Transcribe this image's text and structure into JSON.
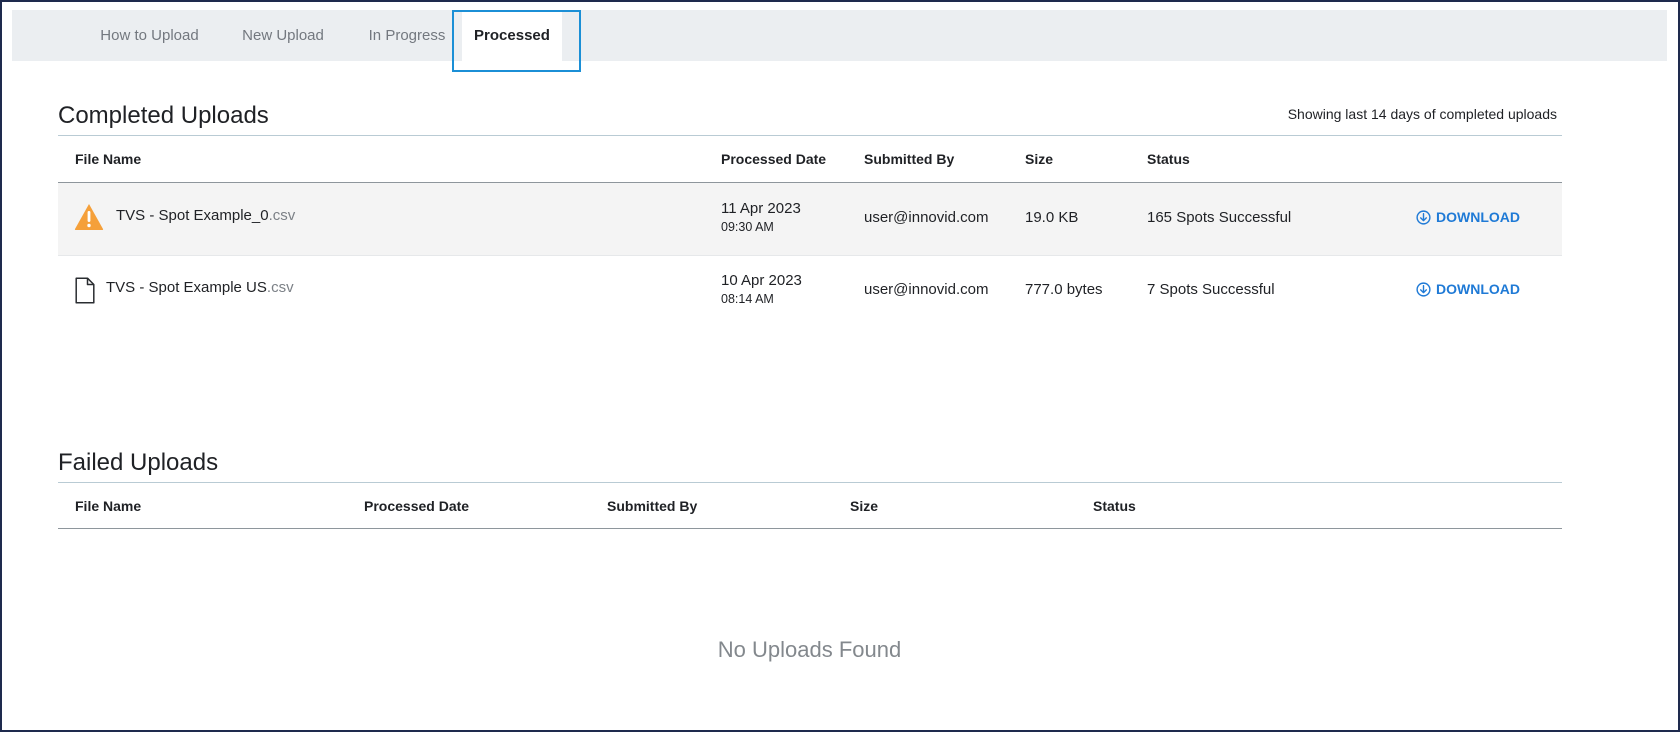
{
  "tabs": [
    {
      "label": "How to Upload"
    },
    {
      "label": "New Upload"
    },
    {
      "label": "In Progress"
    },
    {
      "label": "Processed"
    }
  ],
  "active_tab": "Processed",
  "completed": {
    "title": "Completed Uploads",
    "meta": "Showing last 14 days of completed uploads",
    "headers": {
      "file_name": "File Name",
      "processed_date": "Processed Date",
      "submitted_by": "Submitted By",
      "size": "Size",
      "status": "Status"
    },
    "rows": [
      {
        "icon": "warning-icon",
        "file_base": "TVS - Spot Example_0",
        "file_ext": ".csv",
        "date": "11 Apr 2023",
        "time": "09:30 AM",
        "submitted_by": "user@innovid.com",
        "size": "19.0 KB",
        "status": "165 Spots Successful",
        "action": "DOWNLOAD"
      },
      {
        "icon": "file-icon",
        "file_base": "TVS - Spot Example US",
        "file_ext": ".csv",
        "date": "10 Apr 2023",
        "time": "08:14 AM",
        "submitted_by": "user@innovid.com",
        "size": "777.0 bytes",
        "status": "7 Spots Successful",
        "action": "DOWNLOAD"
      }
    ]
  },
  "failed": {
    "title": "Failed Uploads",
    "headers": {
      "file_name": "File Name",
      "processed_date": "Processed Date",
      "submitted_by": "Submitted By",
      "size": "Size",
      "status": "Status"
    },
    "empty_text": "No Uploads Found"
  },
  "colors": {
    "accent": "#1f7ad6",
    "warning": "#f5a03a",
    "focus_ring": "#1b8fd6",
    "tabbar_bg": "#ebeef1"
  }
}
